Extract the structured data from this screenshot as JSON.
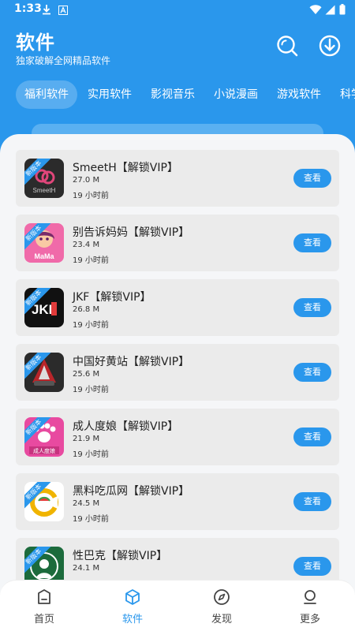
{
  "status": {
    "time": "1:33"
  },
  "header": {
    "title": "软件",
    "subtitle": "独家破解全网精品软件"
  },
  "tabs": [
    {
      "label": "福利软件",
      "active": true
    },
    {
      "label": "实用软件",
      "active": false
    },
    {
      "label": "影视音乐",
      "active": false
    },
    {
      "label": "小说漫画",
      "active": false
    },
    {
      "label": "游戏软件",
      "active": false
    },
    {
      "label": "科学上网",
      "active": false
    }
  ],
  "list": {
    "ribbon": "新版本",
    "view_label": "查看",
    "items": [
      {
        "name": "SmeetH【解锁VIP】",
        "size": "27.0 M",
        "time": "19 小时前",
        "icon_label": "SmeetH",
        "icon_color": "#2b2b2b"
      },
      {
        "name": "别告诉妈妈【解锁VIP】",
        "size": "23.4 M",
        "time": "19 小时前",
        "icon_label": "MaMa",
        "icon_color": "#f06aa9"
      },
      {
        "name": "JKF【解锁VIP】",
        "size": "26.8 M",
        "time": "19 小时前",
        "icon_label": "JKF",
        "icon_color": "#111111"
      },
      {
        "name": "中国好黄站【解锁VIP】",
        "size": "25.6 M",
        "time": "19 小时前",
        "icon_label": "",
        "icon_color": "#2b2b2b"
      },
      {
        "name": "成人度娘【解锁VIP】",
        "size": "21.9 M",
        "time": "19 小时前",
        "icon_label": "成人度娘",
        "icon_color": "#e84aa0"
      },
      {
        "name": "黑料吃瓜网【解锁VIP】",
        "size": "24.5 M",
        "time": "19 小时前",
        "icon_label": "",
        "icon_color": "#ffffff"
      },
      {
        "name": "性巴克【解锁VIP】",
        "size": "24.1 M",
        "time": "",
        "icon_label": "",
        "icon_color": "#1c6b3c"
      }
    ]
  },
  "bottom_nav": [
    {
      "label": "首页",
      "icon": "home-icon",
      "active": false
    },
    {
      "label": "软件",
      "icon": "cube-icon",
      "active": true
    },
    {
      "label": "发现",
      "icon": "compass-icon",
      "active": false
    },
    {
      "label": "更多",
      "icon": "more-person-icon",
      "active": false
    }
  ],
  "colors": {
    "primary": "#2a97ec",
    "card_bg": "#ebebeb",
    "page_bg": "#f5f6f8"
  }
}
